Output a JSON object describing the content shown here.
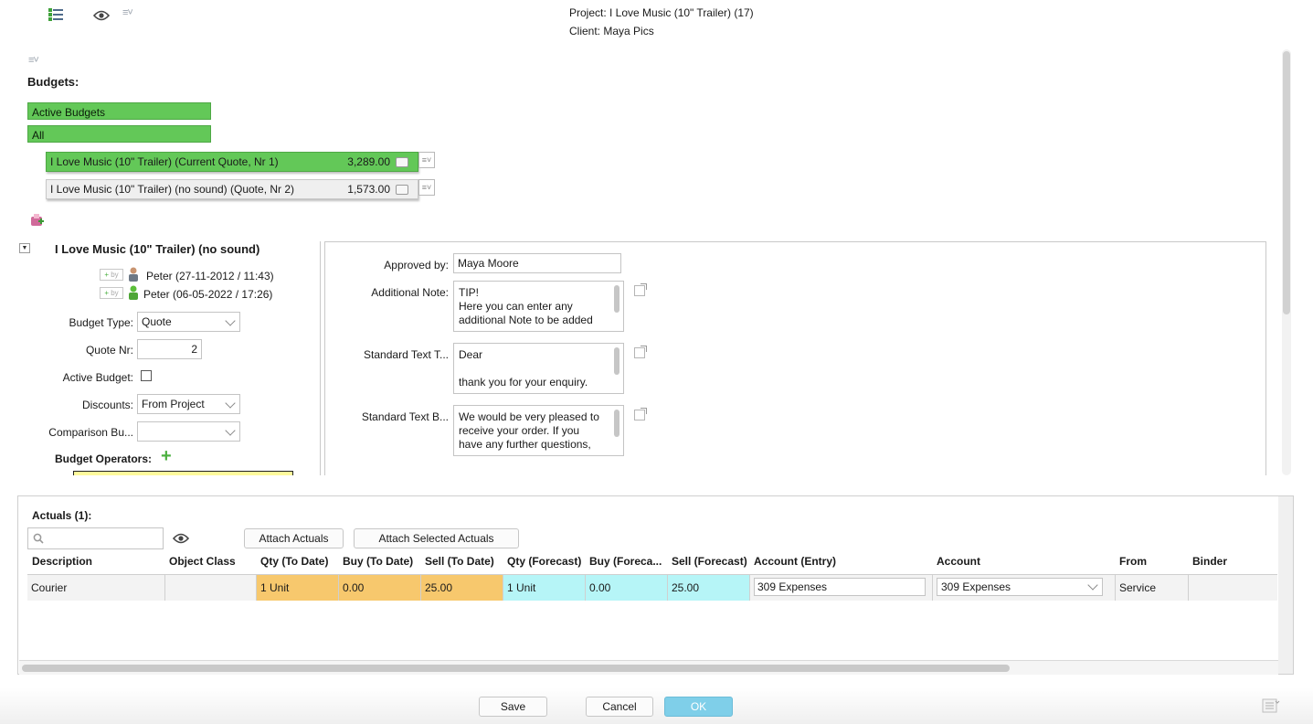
{
  "header": {
    "project": "Project: I Love Music (10\" Trailer) (17)",
    "client": "Client: Maya Pics",
    "list_toggle": "≡˅"
  },
  "budgets": {
    "title": "Budgets:",
    "filters": [
      "Active Budgets",
      "All"
    ],
    "rows": [
      {
        "name": "I Love Music (10\" Trailer) (Current Quote, Nr 1)",
        "amount": "3,289.00",
        "active": true
      },
      {
        "name": "I Love Music (10\" Trailer) (no sound) (Quote, Nr 2)",
        "amount": "1,573.00",
        "active": false
      }
    ]
  },
  "detail": {
    "title": "I Love Music (10\" Trailer) (no sound)",
    "by_tag": "by",
    "created": "Peter (27-11-2012 / 11:43)",
    "modified": "Peter (06-05-2022 / 17:26)",
    "budget_type_label": "Budget Type:",
    "budget_type_value": "Quote",
    "quote_nr_label": "Quote Nr:",
    "quote_nr_value": "2",
    "active_budget_label": "Active Budget:",
    "discounts_label": "Discounts:",
    "discounts_value": "From Project",
    "comparison_label": "Comparison Bu...",
    "comparison_value": "",
    "operators_label": "Budget Operators:",
    "approved_by_label": "Approved by:",
    "approved_by_value": "Maya Moore",
    "additional_note_label": "Additional Note:",
    "additional_note_lines": [
      "TIP!",
      "Here you can enter any",
      "additional Note to be added"
    ],
    "std_text_top_label": "Standard Text T...",
    "std_text_top_lines": [
      "Dear",
      "",
      "thank you for your enquiry."
    ],
    "std_text_bottom_label": "Standard Text B...",
    "std_text_bottom_lines": [
      "We would be very pleased to",
      "receive your order. If you",
      "have any further questions,"
    ]
  },
  "actuals": {
    "title": "Actuals (1):",
    "search_placeholder": "",
    "attach_label": "Attach Actuals",
    "attach_selected_label": "Attach Selected Actuals",
    "columns": [
      "Description",
      "Object Class",
      "Qty (To Date)",
      "Buy (To Date)",
      "Sell (To Date)",
      "Qty (Forecast)",
      "Buy (Foreca...",
      "Sell (Forecast)",
      "Account (Entry)",
      "Account",
      "From",
      "Binder"
    ],
    "rows": [
      {
        "description": "Courier",
        "object_class": "",
        "qty_to_date": "1 Unit",
        "buy_to_date": "0.00",
        "sell_to_date": "25.00",
        "qty_forecast": "1 Unit",
        "buy_forecast": "0.00",
        "sell_forecast": "25.00",
        "account_entry": "309 Expenses",
        "account": "309 Expenses",
        "from": "Service",
        "binder": ""
      }
    ]
  },
  "footer": {
    "save": "Save",
    "cancel": "Cancel",
    "ok": "OK"
  },
  "colors": {
    "active_green": "#63c858",
    "to_date_orange": "#f7c86d",
    "forecast_cyan": "#b6f5f7",
    "ok_blue": "#7fcfe9"
  }
}
